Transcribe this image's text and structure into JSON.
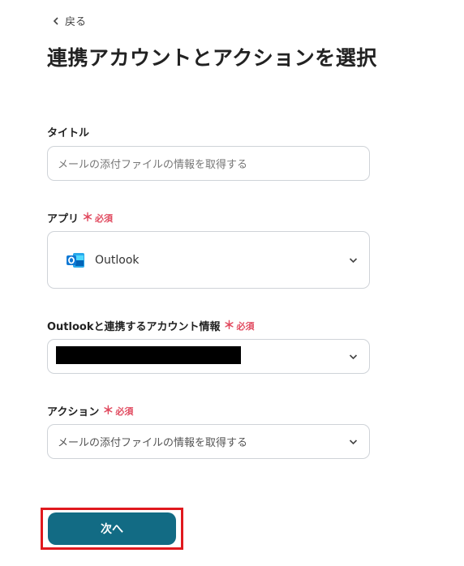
{
  "nav": {
    "back_label": "戻る"
  },
  "page": {
    "title": "連携アカウントとアクションを選択"
  },
  "form": {
    "title_field": {
      "label": "タイトル",
      "value": "メールの添付ファイルの情報を取得する"
    },
    "app_field": {
      "label": "アプリ",
      "required": "必須",
      "value": "Outlook",
      "icon": "outlook-icon"
    },
    "account_field": {
      "label": "Outlookと連携するアカウント情報",
      "required": "必須"
    },
    "action_field": {
      "label": "アクション",
      "required": "必須",
      "value": "メールの添付ファイルの情報を取得する"
    }
  },
  "footer": {
    "next_label": "次へ"
  },
  "colors": {
    "primary": "#126b84",
    "required": "#e14a5f",
    "highlight": "#e0191e",
    "outlook": "#0f78d4"
  }
}
